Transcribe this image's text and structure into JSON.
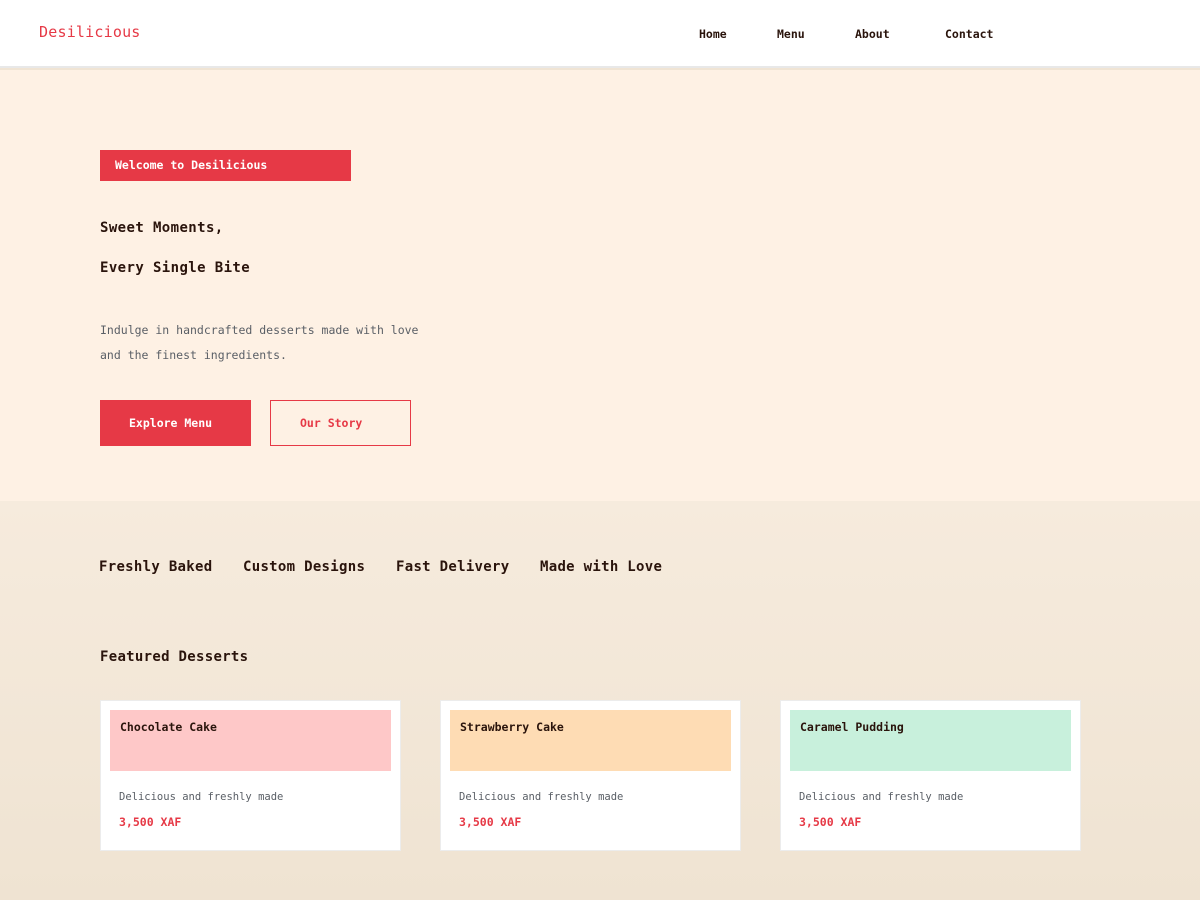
{
  "colors": {
    "accent": "#e63946",
    "hero_background": "#fef1e4",
    "section_background": "#f0e4d4",
    "text_dark": "#2a140c",
    "text_muted": "#5a5f66"
  },
  "header": {
    "logo": "Desilicious",
    "nav": [
      {
        "label": "Home"
      },
      {
        "label": "Menu"
      },
      {
        "label": "About"
      },
      {
        "label": "Contact"
      }
    ]
  },
  "hero": {
    "badge": "Welcome to Desilicious",
    "title_line1": "Sweet Moments,",
    "title_line2": "Every Single Bite",
    "description": "Indulge in handcrafted desserts made with love and the finest ingredients.",
    "primary_button": "Explore Menu",
    "secondary_button": "Our Story"
  },
  "features": [
    {
      "label": "Freshly Baked"
    },
    {
      "label": "Custom Designs"
    },
    {
      "label": "Fast Delivery"
    },
    {
      "label": "Made with Love"
    }
  ],
  "featured": {
    "title": "Featured Desserts",
    "items": [
      {
        "name": "Chocolate Cake",
        "description": "Delicious and freshly made",
        "price": "3,500 XAF",
        "color": "#fec8c8"
      },
      {
        "name": "Strawberry Cake",
        "description": "Delicious and freshly made",
        "price": "3,500 XAF",
        "color": "#fedcb4"
      },
      {
        "name": "Caramel Pudding",
        "description": "Delicious and freshly made",
        "price": "3,500 XAF",
        "color": "#c8f0dc"
      }
    ]
  }
}
